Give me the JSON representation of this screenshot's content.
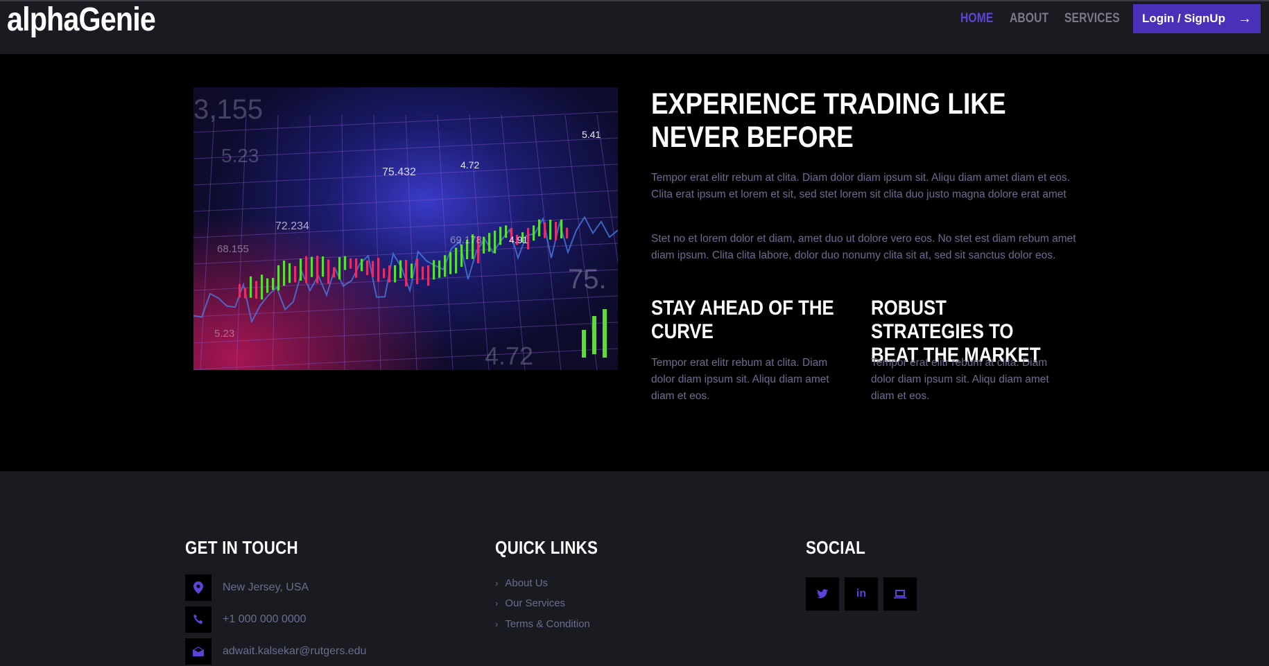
{
  "nav": {
    "logo": "alphaGenie",
    "items": [
      {
        "label": "HOME",
        "active": true
      },
      {
        "label": "ABOUT",
        "active": false
      },
      {
        "label": "SERVICES",
        "active": false
      }
    ],
    "login_label": "Login / SignUp",
    "login_icon": "arrow-right-icon"
  },
  "hero": {
    "image_alt": "",
    "chart_labels": [
      "3,155",
      "5.23",
      "75.432",
      "4.72",
      "5.41",
      "72.234",
      "68.155",
      "69.178",
      "4.91",
      "75.",
      "5.23",
      "4.72"
    ],
    "title": "EXPERIENCE TRADING LIKE NEVER BEFORE",
    "para1": "Tempor erat elitr rebum at clita. Diam dolor diam ipsum sit. Aliqu diam amet diam et eos. Clita erat ipsum et lorem et sit, sed stet lorem sit clita duo justo magna dolore erat amet",
    "para2": "Stet no et lorem dolor et diam, amet duo ut dolore vero eos. No stet est diam rebum amet diam ipsum. Clita clita labore, dolor duo nonumy clita sit at, sed sit sanctus dolor eos.",
    "features": [
      {
        "title": "STAY AHEAD OF THE CURVE",
        "text": "Tempor erat elitr rebum at clita. Diam dolor diam ipsum sit. Aliqu diam amet diam et eos."
      },
      {
        "title": "ROBUST STRATEGIES TO BEAT THE MARKET",
        "text": "Tempor erat elitr rebum at clita. Diam dolor diam ipsum sit. Aliqu diam amet diam et eos."
      }
    ]
  },
  "footer": {
    "contact_title": "GET IN TOUCH",
    "contacts": [
      {
        "icon": "map-pin-icon",
        "text": "New Jersey, USA"
      },
      {
        "icon": "phone-icon",
        "text": "+1 000 000 0000"
      },
      {
        "icon": "envelope-icon",
        "text": "adwait.kalsekar@rutgers.edu"
      }
    ],
    "links_title": "QUICK LINKS",
    "links": [
      "About Us",
      "Our Services",
      "Terms & Condition"
    ],
    "social_title": "SOCIAL",
    "social": [
      "twitter-icon",
      "linkedin-icon",
      "laptop-icon"
    ]
  },
  "colors": {
    "accent": "#5c45d6",
    "button": "#4a2fb8",
    "nav_bg": "#1a1b21",
    "text_muted": "#6c6c90"
  }
}
